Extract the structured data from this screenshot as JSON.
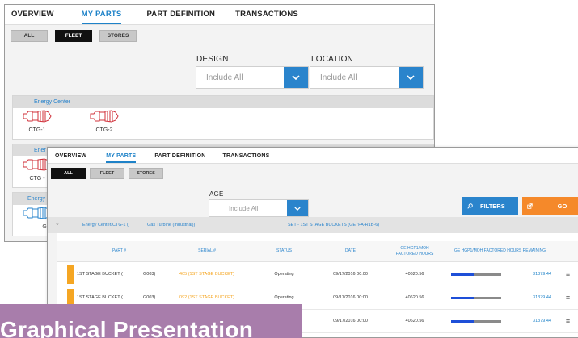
{
  "back_window": {
    "tabs": [
      {
        "label": "OVERVIEW",
        "active": false
      },
      {
        "label": "MY PARTS",
        "active": true
      },
      {
        "label": "PART DEFINITION",
        "active": false
      },
      {
        "label": "TRANSACTIONS",
        "active": false
      }
    ],
    "segments": [
      {
        "label": "ALL",
        "active": false
      },
      {
        "label": "FLEET",
        "active": true
      },
      {
        "label": "STORES",
        "active": false
      }
    ],
    "design": {
      "label": "DESIGN",
      "value": "Include All"
    },
    "location": {
      "label": "LOCATION",
      "value": "Include All"
    },
    "sites": [
      {
        "name": "Energy Center",
        "units": [
          "CTG-1",
          "CTG-2"
        ]
      },
      {
        "name": "Ener",
        "units": [
          "CTG -"
        ]
      },
      {
        "name": "Energy C",
        "units": [
          "GT1"
        ]
      }
    ]
  },
  "front_window": {
    "tabs": [
      {
        "label": "OVERVIEW",
        "active": false
      },
      {
        "label": "MY PARTS",
        "active": true
      },
      {
        "label": "PART DEFINITION",
        "active": false
      },
      {
        "label": "TRANSACTIONS",
        "active": false
      }
    ],
    "segments": [
      {
        "label": "ALL",
        "active": true
      },
      {
        "label": "FLEET",
        "active": false
      },
      {
        "label": "STORES",
        "active": false
      }
    ],
    "age": {
      "label": "AGE",
      "value": "Include All"
    },
    "filters_label": "FILTERS",
    "go_label": "GO",
    "set_bar": {
      "chevron": "⌄",
      "site": "Energy Center/CTG-1 (",
      "type": "Gas Turbine (Industrial))",
      "set": "SET - 1ST STAGE BUCKETS (GE7FA-R1B-6)"
    },
    "table": {
      "headers": {
        "part": "PART #",
        "serial": "SERIAL #",
        "status": "STATUS",
        "date": "DATE",
        "hours": "GE HGP1/MOH FACTORED HOURS",
        "remaining": "GE HGP1/MOH FACTORED HOURS REMAINING"
      },
      "rows": [
        {
          "part": "1ST STAGE BUCKET (",
          "code": "G003)",
          "serial": "405 (1ST STAGE BUCKET)",
          "status": "Operating",
          "date": "09/17/2016 00:00",
          "hours": "40620.56",
          "remaining": "31379.44",
          "remaining_fraction": 0.45
        },
        {
          "part": "1ST STAGE BUCKET (",
          "code": "G003)",
          "serial": "092 (1ST STAGE BUCKET)",
          "status": "Operating",
          "date": "09/17/2016 00:00",
          "hours": "40620.56",
          "remaining": "31379.44",
          "remaining_fraction": 0.45
        },
        {
          "part": "",
          "code": "",
          "serial": "",
          "status": "",
          "date": "09/17/2016 00:00",
          "hours": "40620.56",
          "remaining": "31379.44",
          "remaining_fraction": 0.45
        }
      ]
    }
  },
  "banner": {
    "text": "Graphical Presentation"
  },
  "colors": {
    "accent_blue": "#2a84cc",
    "accent_orange": "#f5a623",
    "banner_purple": "#a87dab",
    "progress_blue": "#1e4fd8"
  },
  "icons": {
    "dropdown": "chevron-down-icon",
    "filters": "search-icon",
    "go": "external-link-icon",
    "row_menu": "hamburger-menu-icon",
    "unit": "turbine-icon"
  }
}
